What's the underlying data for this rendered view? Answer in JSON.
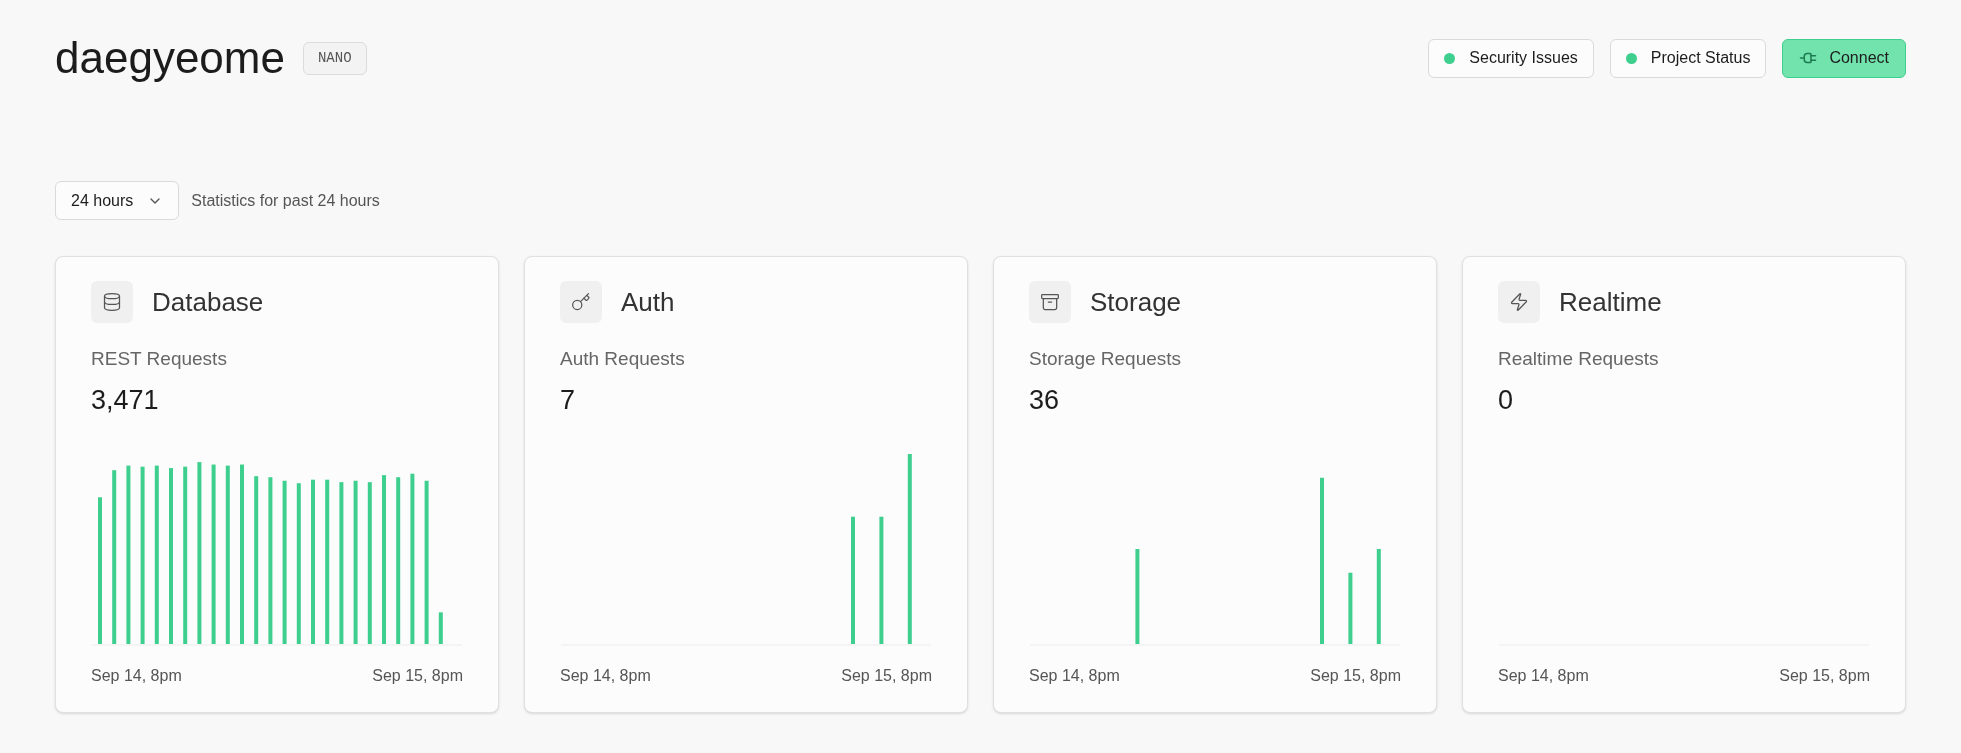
{
  "project": {
    "name": "daegyeome",
    "plan": "NANO"
  },
  "header_buttons": [
    {
      "kind": "status",
      "label": "Security Issues",
      "color": "#3ecf8e"
    },
    {
      "kind": "status",
      "label": "Project Status",
      "color": "#3ecf8e"
    },
    {
      "kind": "primary",
      "label": "Connect"
    }
  ],
  "period": {
    "value": "24 hours",
    "caption": "Statistics for past 24 hours"
  },
  "cards": [
    {
      "kind": "database",
      "title": "Database",
      "metric": "REST Requests",
      "value": "3,471",
      "x_start": "Sep 14, 8pm",
      "x_end": "Sep 15, 8pm"
    },
    {
      "kind": "auth",
      "title": "Auth",
      "metric": "Auth Requests",
      "value": "7",
      "x_start": "Sep 14, 8pm",
      "x_end": "Sep 15, 8pm"
    },
    {
      "kind": "storage",
      "title": "Storage",
      "metric": "Storage Requests",
      "value": "36",
      "x_start": "Sep 14, 8pm",
      "x_end": "Sep 15, 8pm"
    },
    {
      "kind": "realtime",
      "title": "Realtime",
      "metric": "Realtime Requests",
      "value": "0",
      "x_start": "Sep 14, 8pm",
      "x_end": "Sep 15, 8pm"
    }
  ]
}
